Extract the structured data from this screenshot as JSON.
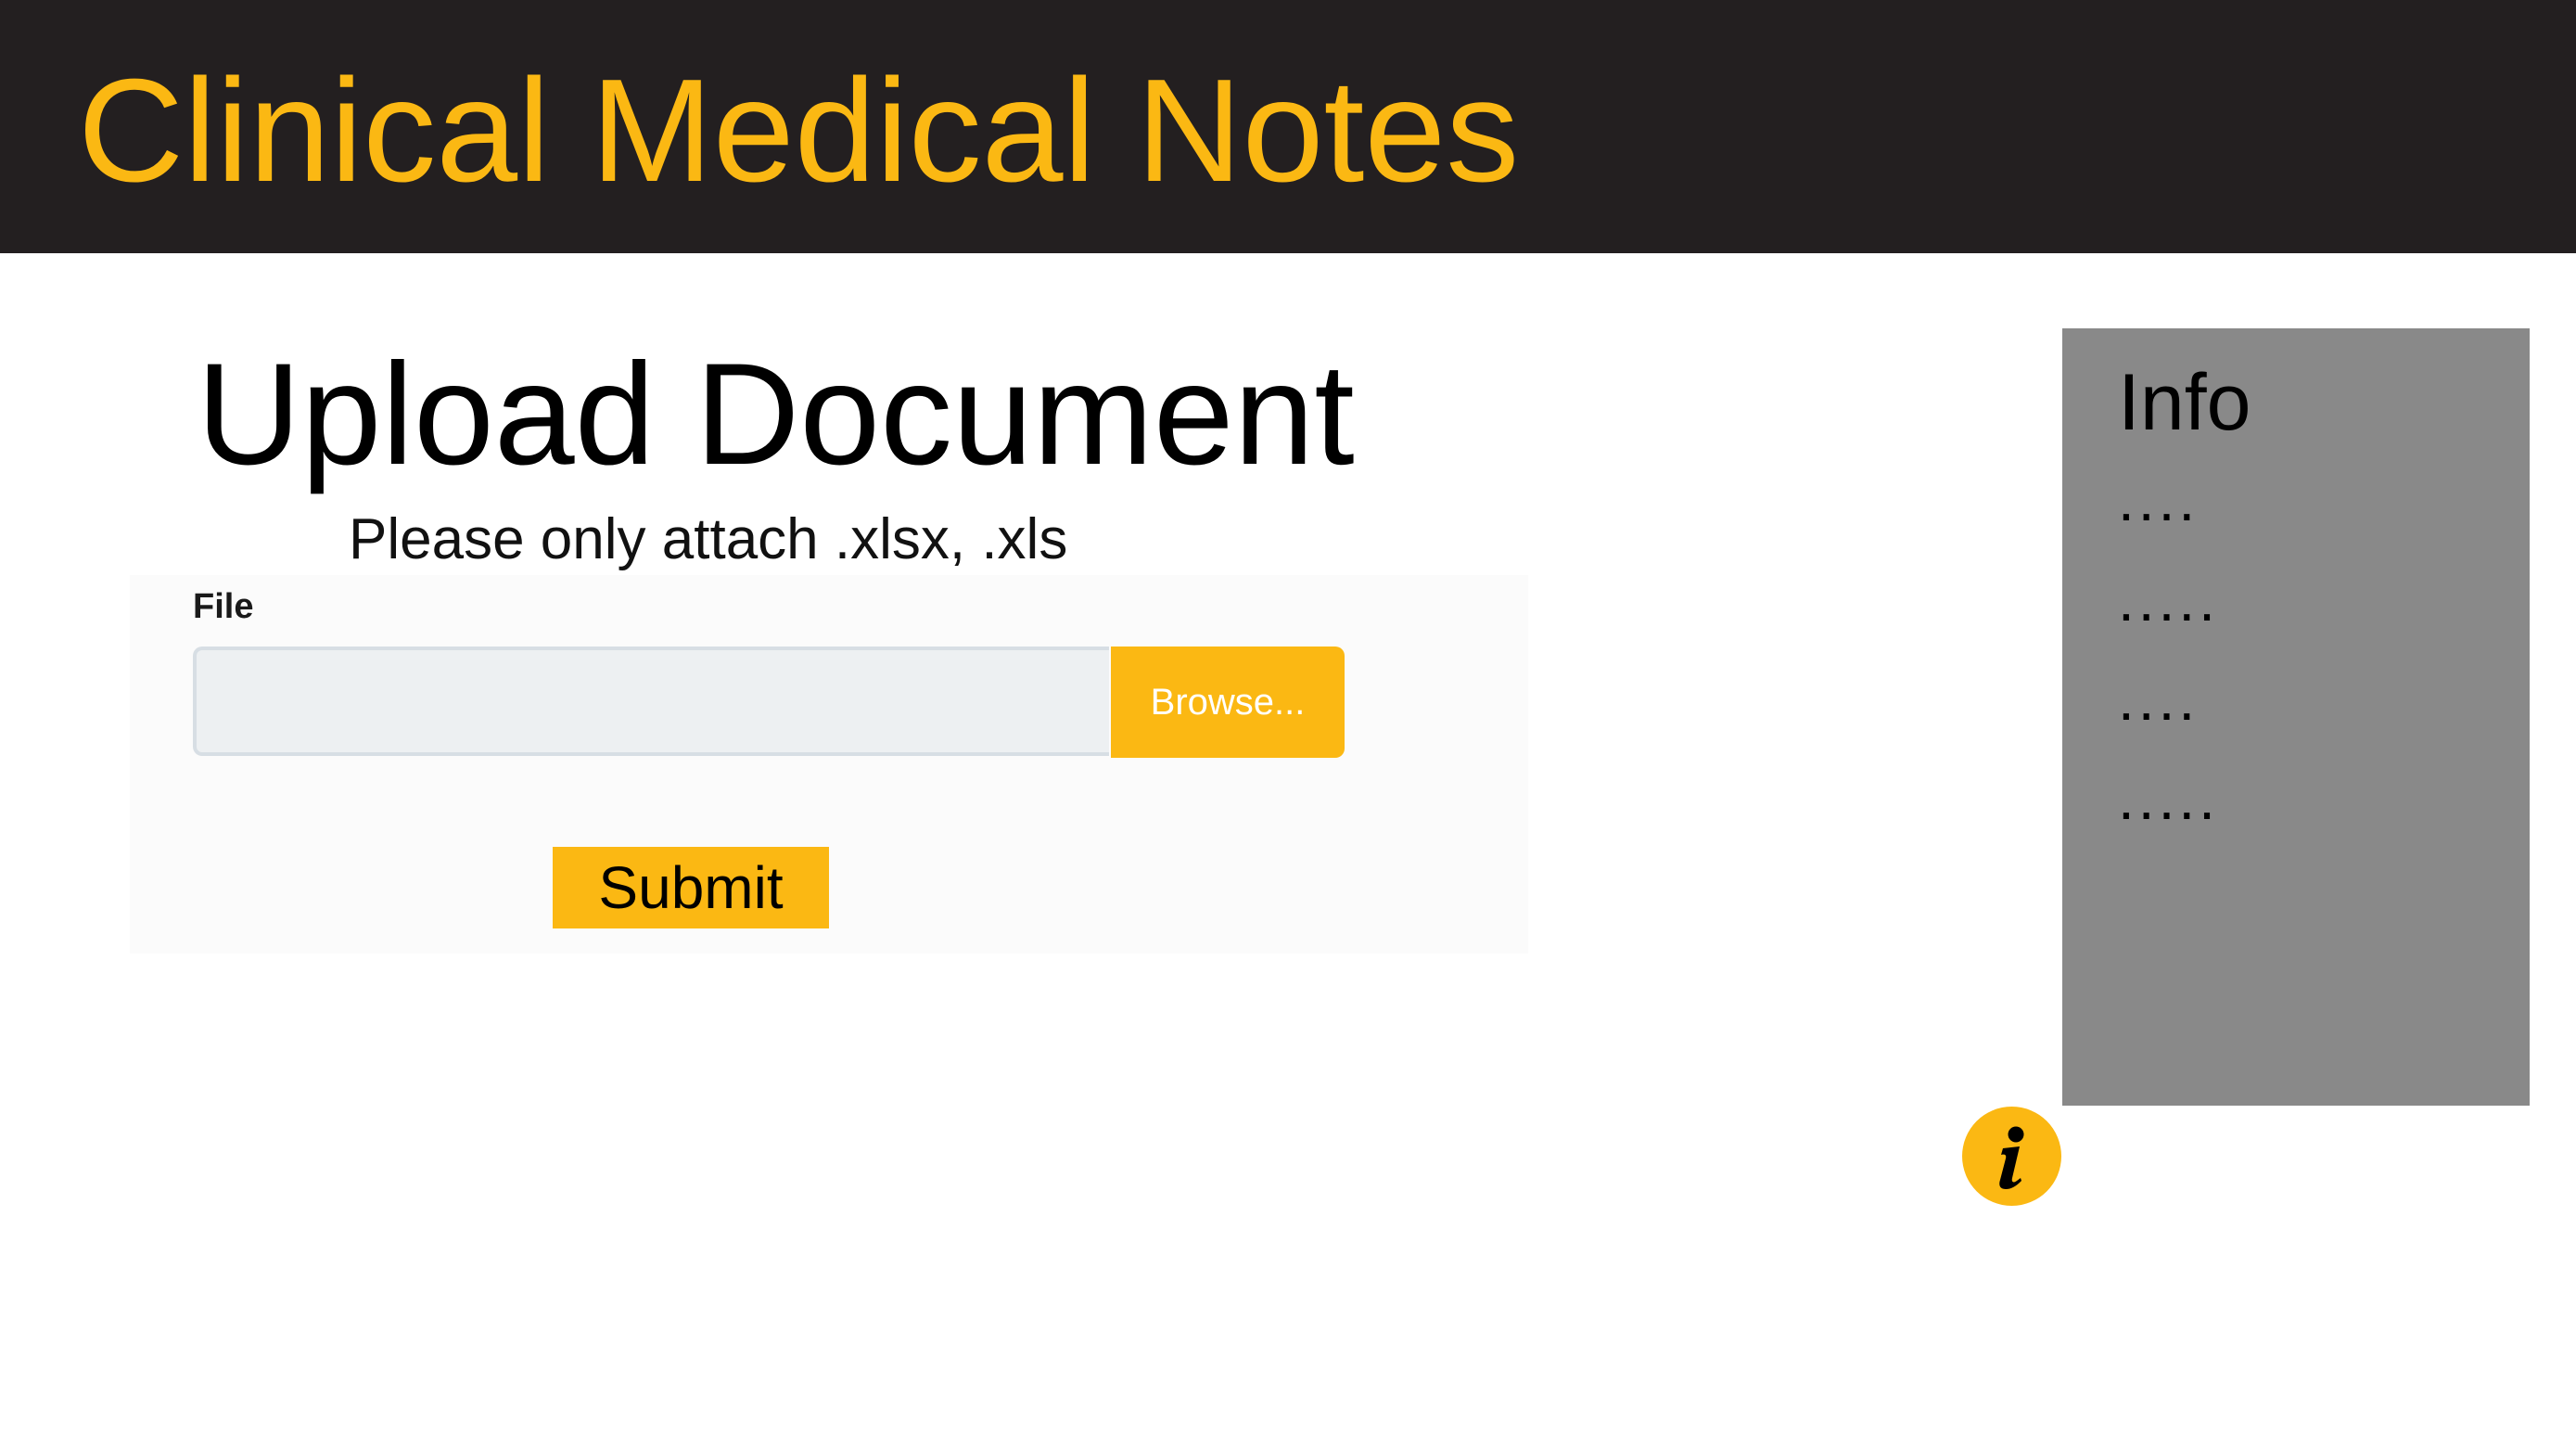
{
  "header": {
    "title": "Clinical Medical Notes"
  },
  "upload": {
    "title": "Upload Document",
    "hint": "Please only attach .xlsx, .xls",
    "file_label": "File",
    "file_value": "",
    "browse_label": "Browse...",
    "submit_label": "Submit"
  },
  "info_panel": {
    "title": "Info",
    "lines": [
      "....",
      ".....",
      "....",
      "....."
    ]
  },
  "info_button": {
    "icon": "info-icon"
  },
  "colors": {
    "header_bg": "#231f20",
    "accent": "#fbb813",
    "info_panel_bg": "#898989",
    "input_bg": "#edf0f2"
  }
}
